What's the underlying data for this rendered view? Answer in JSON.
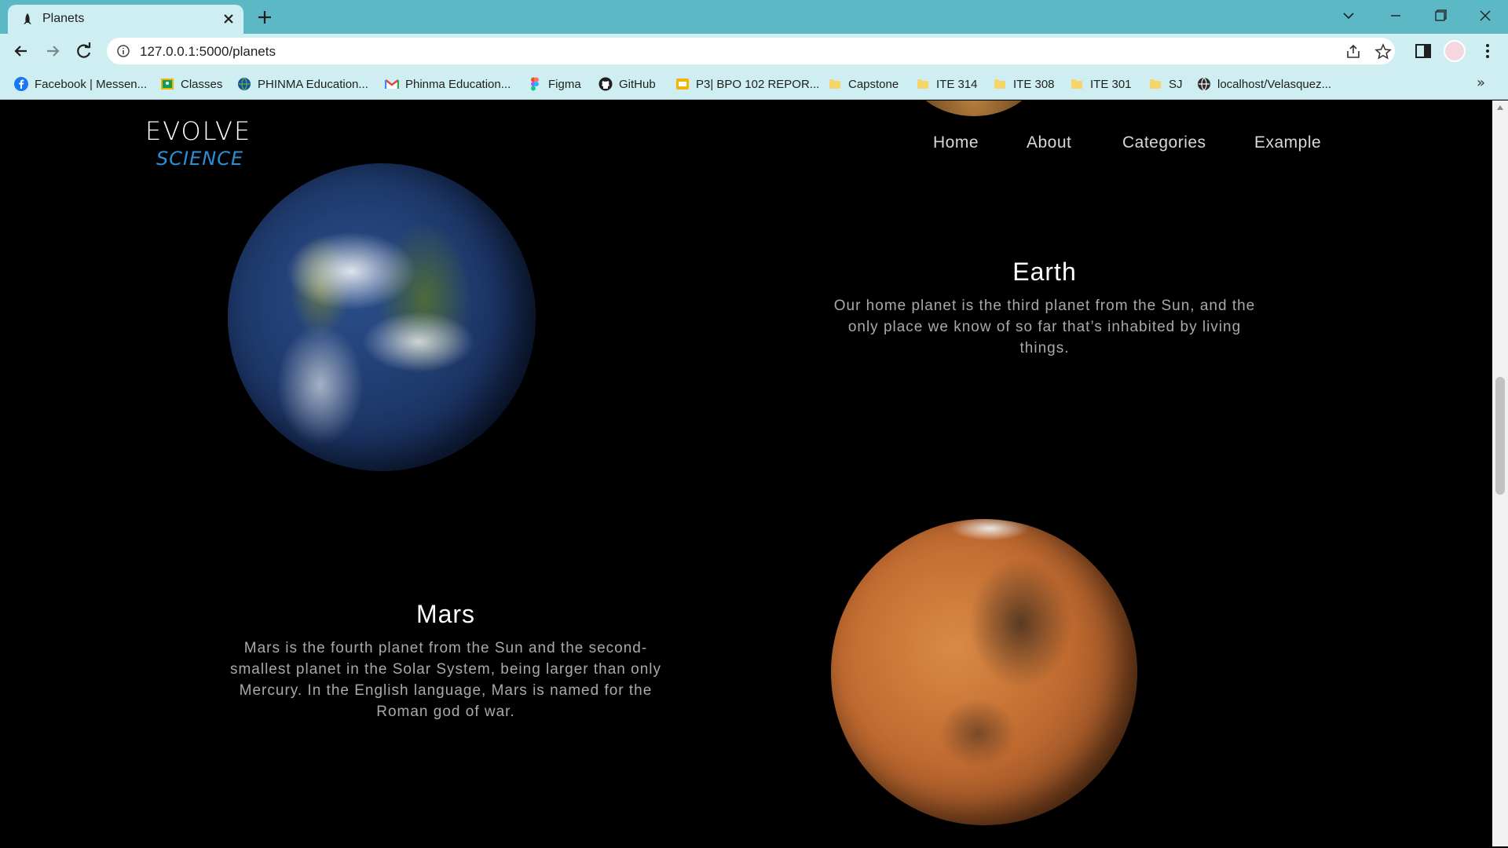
{
  "browser": {
    "tab_title": "Planets",
    "url": "127.0.0.1:5000/planets",
    "bookmarks": [
      {
        "label": "Facebook | Messen...",
        "icon": "facebook-icon"
      },
      {
        "label": "Classes",
        "icon": "classroom-icon"
      },
      {
        "label": "PHINMA Education...",
        "icon": "globe-icon"
      },
      {
        "label": "Phinma Education...",
        "icon": "gmail-icon"
      },
      {
        "label": "Figma",
        "icon": "figma-icon"
      },
      {
        "label": "GitHub",
        "icon": "github-icon"
      },
      {
        "label": "P3| BPO 102 REPOR...",
        "icon": "slides-icon"
      },
      {
        "label": "Capstone",
        "icon": "folder-icon"
      },
      {
        "label": "ITE 314",
        "icon": "folder-icon"
      },
      {
        "label": "ITE 308",
        "icon": "folder-icon"
      },
      {
        "label": "ITE 301",
        "icon": "folder-icon"
      },
      {
        "label": "SJ",
        "icon": "folder-icon"
      },
      {
        "label": "localhost/Velasquez...",
        "icon": "globe-icon"
      }
    ],
    "more_bookmarks": "»"
  },
  "site": {
    "logo_top": "EVOLVE",
    "logo_bottom": "SCIENCE",
    "nav": [
      "Home",
      "About",
      "Categories",
      "Example"
    ]
  },
  "planets": [
    {
      "name": "Earth",
      "description": "Our home planet is the third planet from the Sun, and the only place we know of so far that’s inhabited by living things."
    },
    {
      "name": "Mars",
      "description": "Mars is the fourth planet from the Sun and the second-smallest planet in the Solar System, being larger than only Mercury. In the English language, Mars is named for the Roman god of war."
    }
  ],
  "colors": {
    "tab_strip": "#5bb8c4",
    "toolbar": "#cfeef1",
    "page_bg": "#000000",
    "logo_accent": "#2a8fd6"
  }
}
